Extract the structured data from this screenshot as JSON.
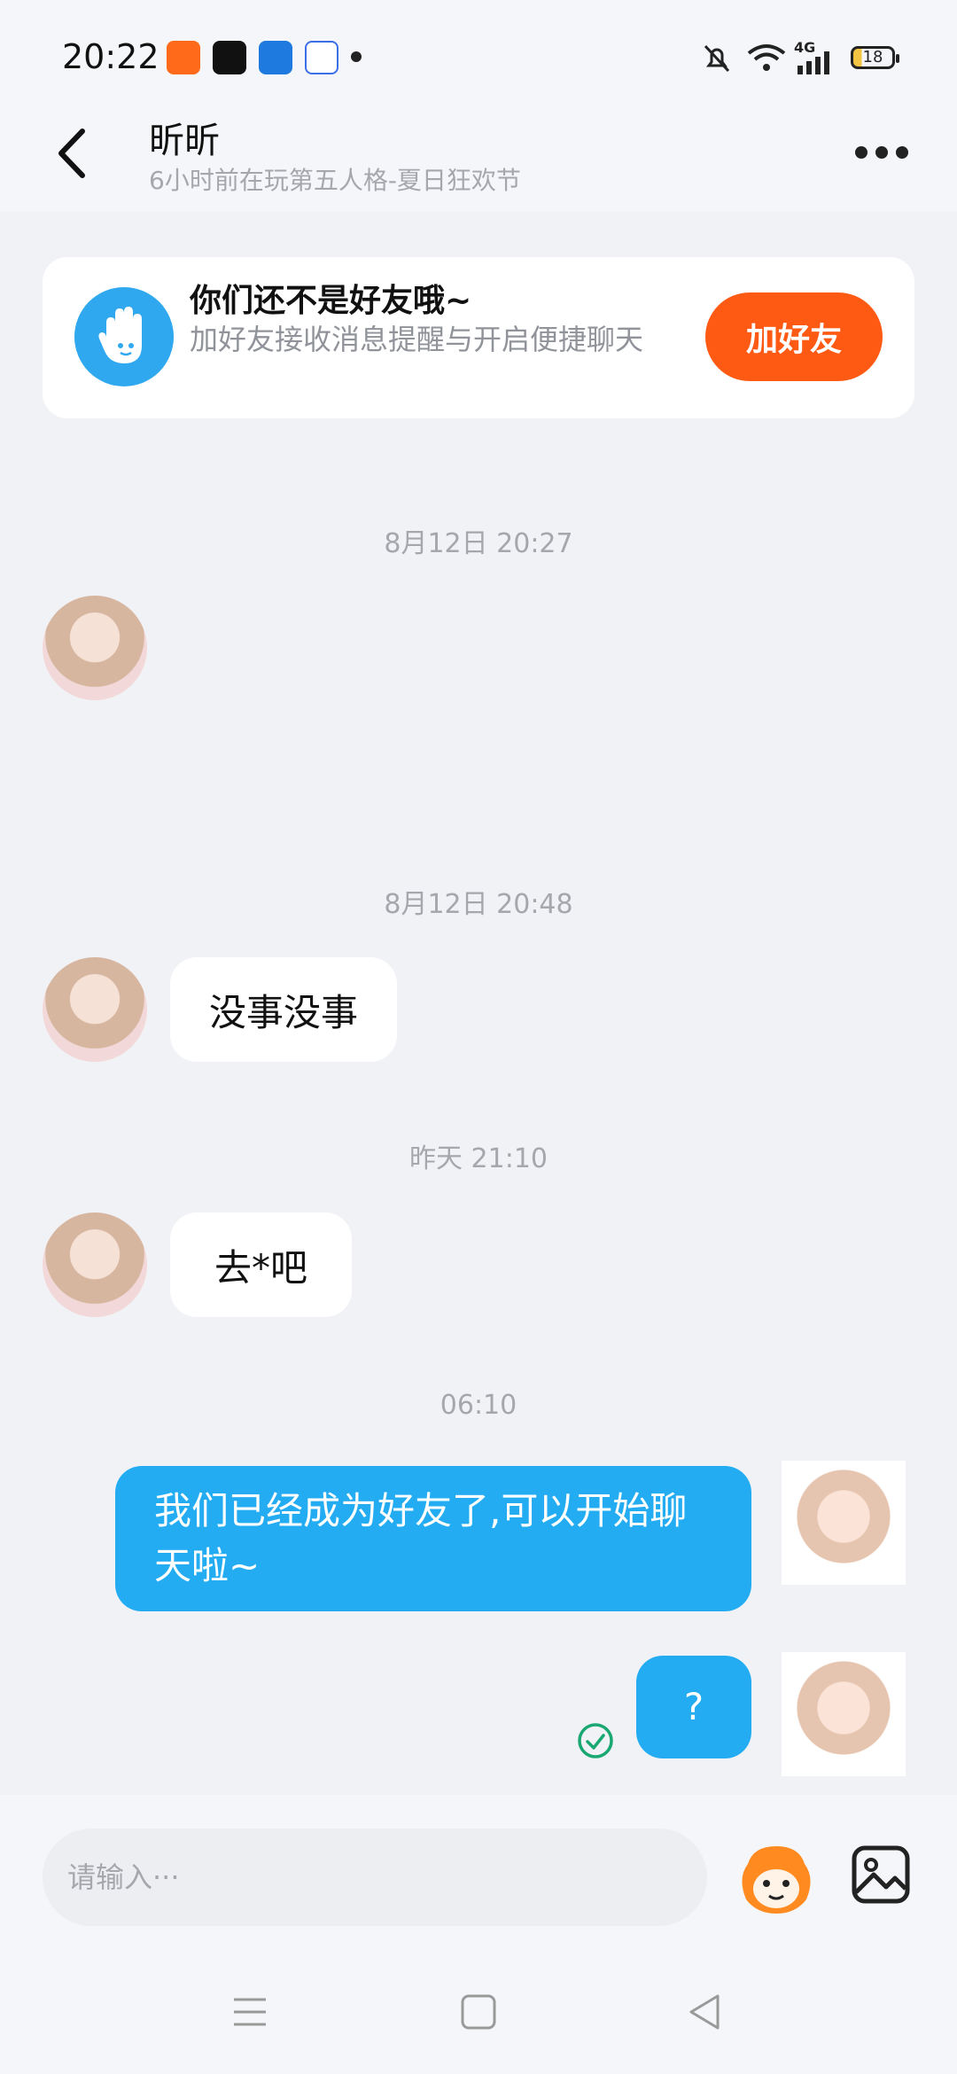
{
  "status_bar": {
    "time": "20:22",
    "battery": "18",
    "network": "4G"
  },
  "header": {
    "contact_name": "昕昕",
    "contact_status": "6小时前在玩第五人格-夏日狂欢节"
  },
  "friend_card": {
    "title": "你们还不是好友哦~",
    "description": "加好友接收消息提醒与开启便捷聊天",
    "button_label": "加好友"
  },
  "messages": [
    {
      "type": "timestamp",
      "text": "8月12日 20:27"
    },
    {
      "type": "timestamp",
      "text": "8月12日 20:48"
    },
    {
      "type": "incoming",
      "text": "没事没事"
    },
    {
      "type": "timestamp",
      "text": "昨天 21:10"
    },
    {
      "type": "incoming",
      "text": "去*吧"
    },
    {
      "type": "timestamp",
      "text": "06:10"
    },
    {
      "type": "outgoing",
      "text": "我们已经成为好友了,可以开始聊天啦~"
    },
    {
      "type": "outgoing",
      "text": "?"
    }
  ],
  "input": {
    "placeholder": "请输入···"
  },
  "colors": {
    "accent": "#24acf2",
    "add_friend": "#ff5a14",
    "background": "#f1f2f6"
  }
}
